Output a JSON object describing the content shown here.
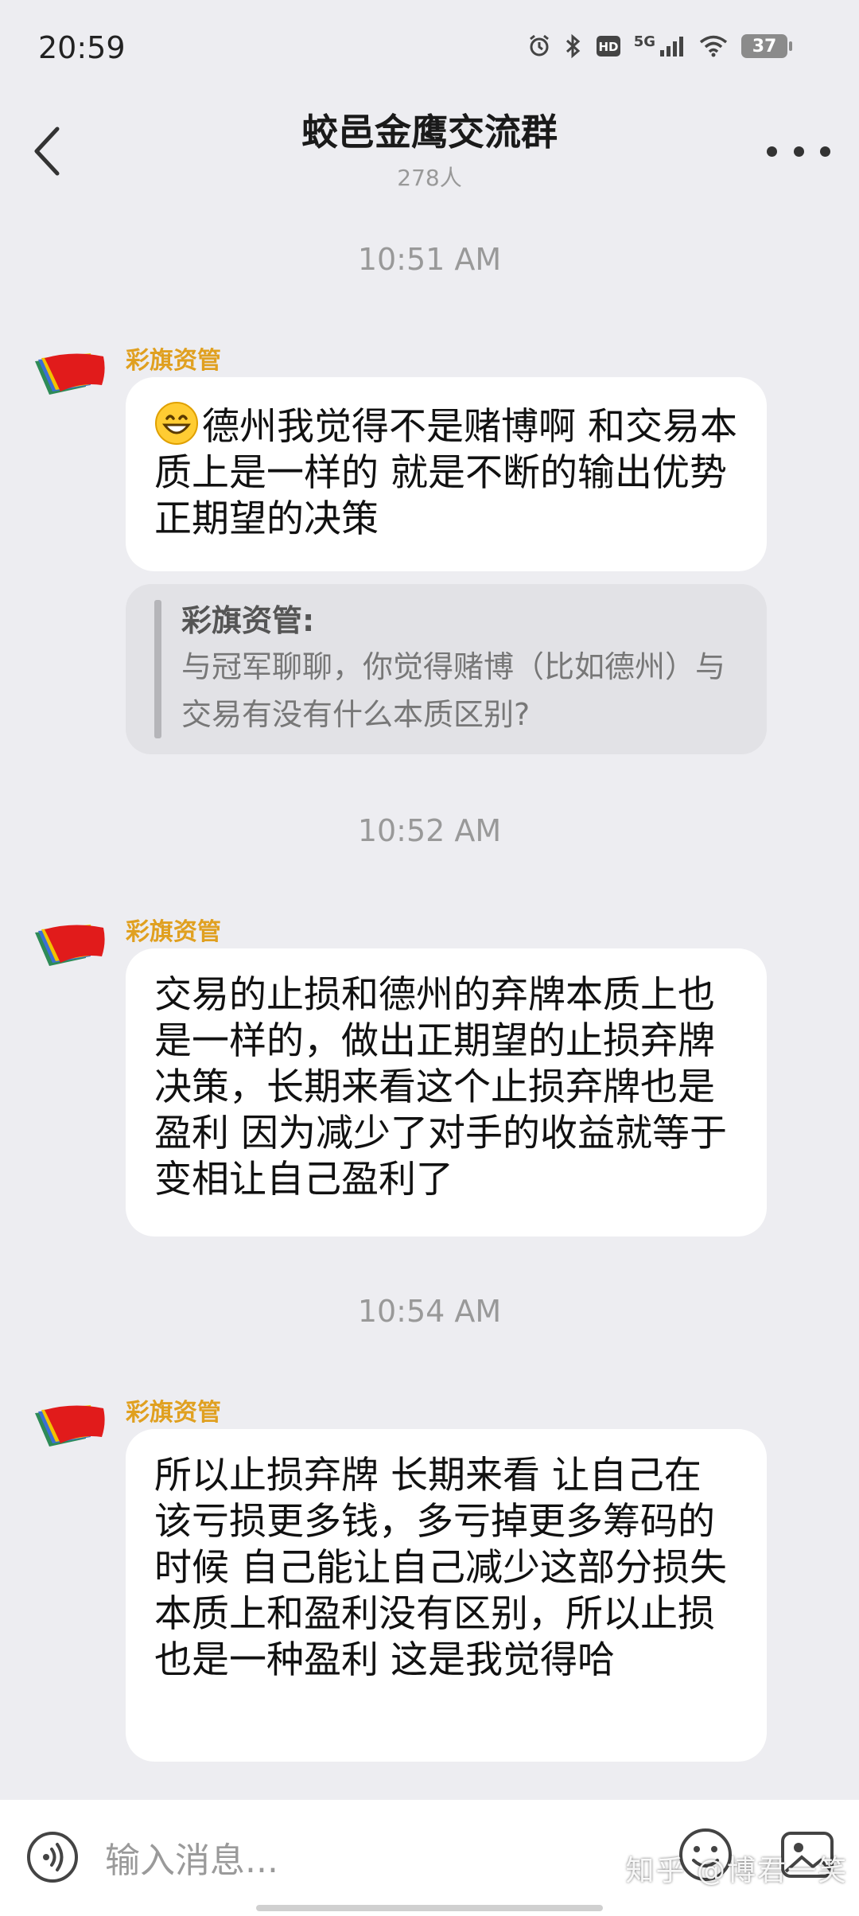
{
  "status_bar": {
    "time": "20:59",
    "network": "5G",
    "battery": "37"
  },
  "header": {
    "title": "蛟邑金鹰交流群",
    "member_count": "278人"
  },
  "messages": [
    {
      "time": "10:51 AM",
      "sender": "彩旗资管",
      "text": "德州我觉得不是赌博啊 和交易本质上是一样的 就是不断的输出优势正期望的决策",
      "emoji": "grinning-face",
      "quote": {
        "author": "彩旗资管:",
        "text": "与冠军聊聊，你觉得赌博（比如德州）与交易有没有什么本质区别?"
      }
    },
    {
      "time": "10:52 AM",
      "sender": "彩旗资管",
      "text": "交易的止损和德州的弃牌本质上也是一样的，做出正期望的止损弃牌决策，长期来看这个止损弃牌也是盈利 因为减少了对手的收益就等于变相让自己盈利了"
    },
    {
      "time": "10:54 AM",
      "sender": "彩旗资管",
      "text": "所以止损弃牌 长期来看 让自己在该亏损更多钱，多亏掉更多筹码的时候 自己能让自己减少这部分损失 本质上和盈利没有区别，所以止损也是一种盈利 这是我觉得哈"
    }
  ],
  "input": {
    "placeholder": "输入消息..."
  },
  "watermark": "知乎 @博君一笑",
  "colors": {
    "background": "#EDEDF1",
    "sender": "#E0A020",
    "bubble": "#FFFFFF",
    "quote_bg": "#E2E2E6"
  }
}
